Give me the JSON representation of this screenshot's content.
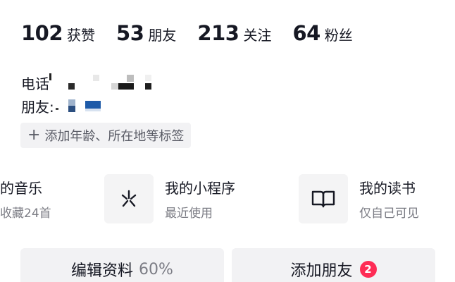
{
  "stats": [
    {
      "num": "102",
      "label": "获赞"
    },
    {
      "num": "53",
      "label": "朋友"
    },
    {
      "num": "213",
      "label": "关注"
    },
    {
      "num": "64",
      "label": "粉丝"
    }
  ],
  "info": {
    "phone_label": "电话",
    "friend_label": "朋友:"
  },
  "tag": {
    "plus": "+",
    "label": "添加年龄、所在地等标签"
  },
  "tools": [
    {
      "title": "的音乐",
      "subtitle": "收藏24首",
      "icon": "music-icon"
    },
    {
      "title": "我的小程序",
      "subtitle": "最近使用",
      "icon": "mini-program-icon"
    },
    {
      "title": "我的读书",
      "subtitle": "仅自己可见",
      "icon": "book-icon"
    }
  ],
  "buttons": {
    "edit_label": "编辑资料",
    "edit_progress": "60%",
    "add_friend_label": "添加朋友",
    "add_friend_badge": "2"
  },
  "colors": {
    "text": "#161823",
    "muted": "#7c7d85",
    "chip_bg": "#f2f2f4",
    "badge": "#fe2c55"
  }
}
